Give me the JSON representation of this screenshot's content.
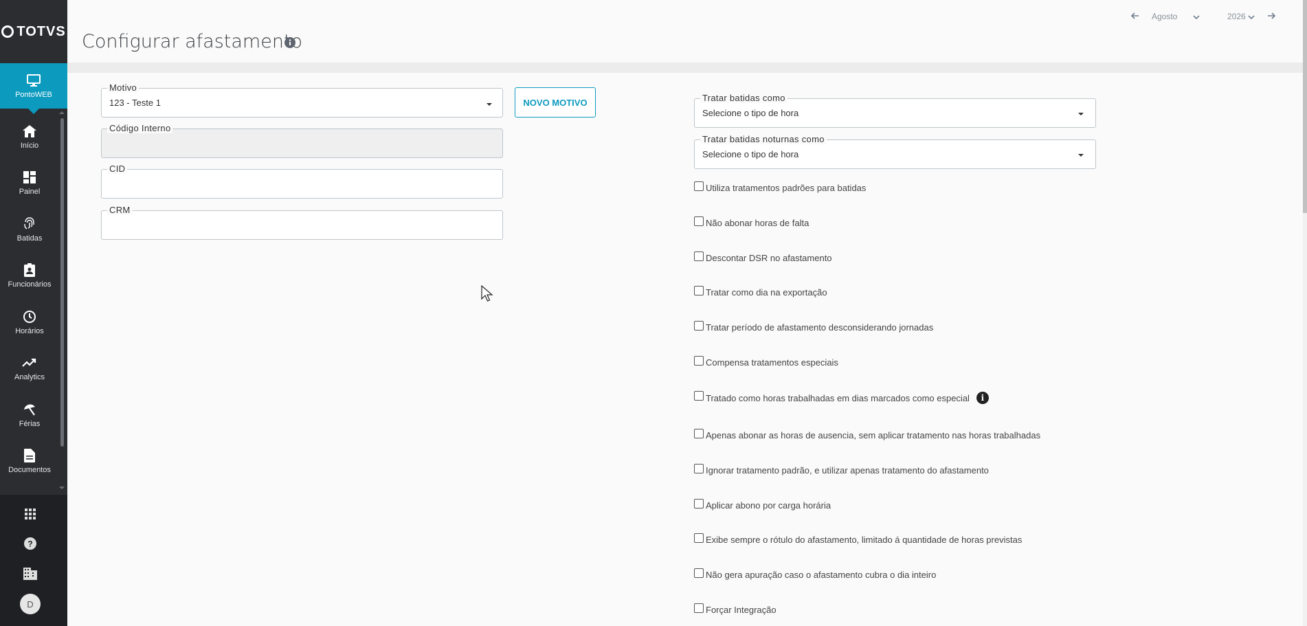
{
  "brand": {
    "logo_text": "TOTVS"
  },
  "sidebar": {
    "active": {
      "label": "PontoWEB",
      "icon": "monitor-icon"
    },
    "items": [
      {
        "label": "Início",
        "icon": "home-icon"
      },
      {
        "label": "Painel",
        "icon": "dashboard-icon"
      },
      {
        "label": "Batidas",
        "icon": "fingerprint-icon"
      },
      {
        "label": "Funcionários",
        "icon": "clipboard-user-icon"
      },
      {
        "label": "Horários",
        "icon": "clock-icon"
      },
      {
        "label": "Analytics",
        "icon": "trending-up-icon"
      },
      {
        "label": "Férias",
        "icon": "beach-umbrella-icon"
      },
      {
        "label": "Documentos",
        "icon": "document-icon"
      }
    ],
    "bottom": {
      "apps_icon": "apps-grid-icon",
      "help_icon": "help-icon",
      "company_icon": "building-icon",
      "avatar_initial": "D"
    }
  },
  "header": {
    "title": "Configurar afastamento",
    "month": "Agosto",
    "year": "2026"
  },
  "form": {
    "motivo": {
      "label": "Motivo",
      "value": "123 - Teste 1"
    },
    "codigo_interno": {
      "label": "Código Interno",
      "value": ""
    },
    "cid": {
      "label": "CID",
      "value": ""
    },
    "crm": {
      "label": "CRM",
      "value": ""
    },
    "novo_motivo_button": "NOVO MOTIVO",
    "tratar_batidas": {
      "label": "Tratar batidas como",
      "placeholder": "Selecione o tipo de hora"
    },
    "tratar_noturnas": {
      "label": "Tratar batidas noturnas como",
      "placeholder": "Selecione o tipo de hora"
    }
  },
  "checkboxes": [
    {
      "label": "Utiliza tratamentos padrões para batidas",
      "checked": false
    },
    {
      "label": "Não abonar horas de falta",
      "checked": false
    },
    {
      "label": "Descontar DSR no afastamento",
      "checked": false
    },
    {
      "label": "Tratar como dia na exportação",
      "checked": false
    },
    {
      "label": "Tratar período de afastamento desconsiderando jornadas",
      "checked": false
    },
    {
      "label": "Compensa tratamentos especiais",
      "checked": false
    },
    {
      "label": "Tratado como horas trabalhadas em dias marcados como especial",
      "checked": false,
      "info": true
    },
    {
      "label": "Apenas abonar as horas de ausencia, sem aplicar tratamento nas horas trabalhadas",
      "checked": false
    },
    {
      "label": "Ignorar tratamento padrão, e utilizar apenas tratamento do afastamento",
      "checked": false
    },
    {
      "label": "Aplicar abono por carga horária",
      "checked": false
    },
    {
      "label": "Exibe sempre o rótulo do afastamento, limitado á quantidade de horas previstas",
      "checked": false
    },
    {
      "label": "Não gera apuração caso o afastamento cubra o dia inteiro",
      "checked": false
    },
    {
      "label": "Forçar Integração",
      "checked": false
    }
  ],
  "colors": {
    "accent": "#0c9abe",
    "sidebar": "#2b2d31",
    "sidebar_bottom": "#1f2024"
  }
}
